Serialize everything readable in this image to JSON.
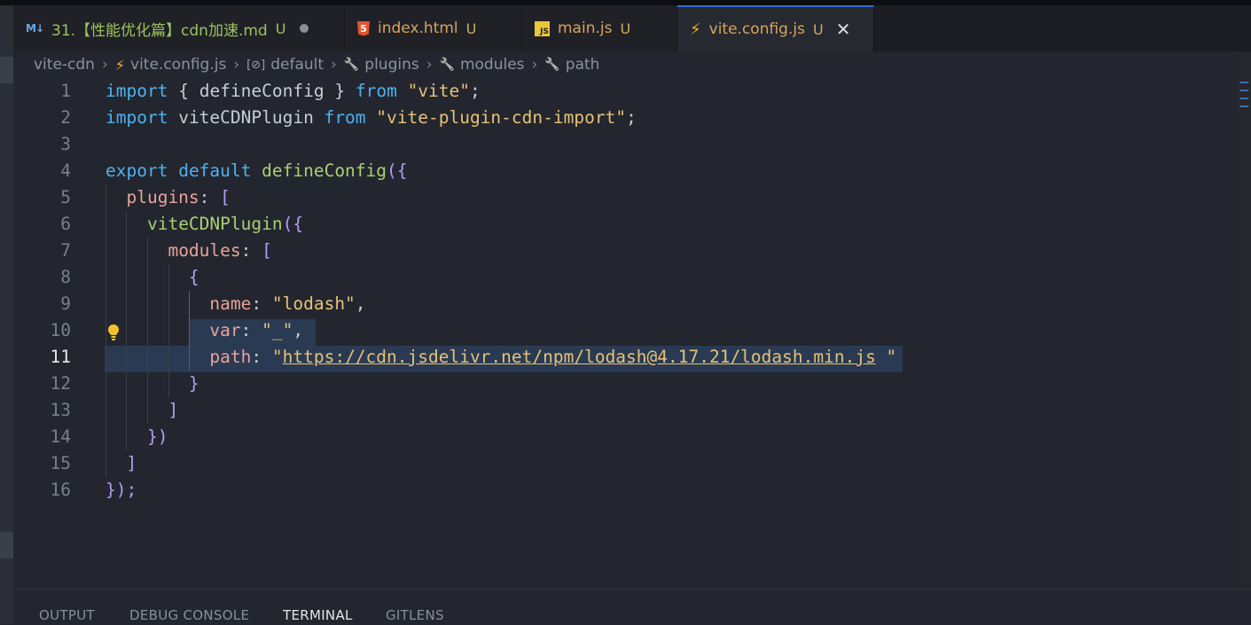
{
  "tabs": [
    {
      "icon": "markdown-icon",
      "icon_text": "M↓",
      "name": "31.【性能优化篇】cdn加速.md",
      "status": "U",
      "modified": true
    },
    {
      "icon": "html-icon",
      "icon_text": "5",
      "name": "index.html",
      "status": "U"
    },
    {
      "icon": "javascript-icon",
      "icon_text": "JS",
      "name": "main.js",
      "status": "U"
    },
    {
      "icon": "vite-icon",
      "icon_text": "⚡",
      "name": "vite.config.js",
      "status": "U",
      "active": true,
      "close": "✕"
    }
  ],
  "breadcrumb": {
    "folder": "vite-cdn",
    "file": "vite.config.js",
    "default": "default",
    "plugins": "plugins",
    "modules": "modules",
    "path": "path",
    "sep": "›",
    "symbol_text": "[⊘]",
    "wrench": "🔧",
    "vite_glyph": "⚡"
  },
  "editor": {
    "current_line": 11,
    "lines": [
      {
        "n": "1"
      },
      {
        "n": "2"
      },
      {
        "n": "3"
      },
      {
        "n": "4"
      },
      {
        "n": "5"
      },
      {
        "n": "6"
      },
      {
        "n": "7"
      },
      {
        "n": "8"
      },
      {
        "n": "9"
      },
      {
        "n": "10"
      },
      {
        "n": "11"
      },
      {
        "n": "12"
      },
      {
        "n": "13"
      },
      {
        "n": "14"
      },
      {
        "n": "15"
      },
      {
        "n": "16"
      }
    ],
    "tokens": {
      "import": "import",
      "from": "from",
      "export": "export",
      "default": "default",
      "lbrace": "{",
      "rbrace": "}",
      "defineConfig": "defineConfig",
      "vite_str": "\"vite\"",
      "semi": ";",
      "viteCDNPlugin": "viteCDNPlugin",
      "plugin_str": "\"vite-plugin-cdn-import\"",
      "paren_open": "({",
      "plugins": "plugins",
      "colon": ":",
      "lbracket": "[",
      "rbracket": "]",
      "modules": "modules",
      "name": "name",
      "lodash_str": "\"lodash\"",
      "comma": ",",
      "var": "var",
      "underscore_str": "\"_\"",
      "path": "path",
      "quote": "\"",
      "url": "https://cdn.jsdelivr.net/npm/lodash@4.17.21/lodash.min.js",
      "url_end": " \"",
      "paren_close": "})",
      "end": "});"
    }
  },
  "panel": {
    "tabs": [
      "OUTPUT",
      "DEBUG CONSOLE",
      "TERMINAL",
      "GITLENS"
    ],
    "active": "TERMINAL"
  }
}
